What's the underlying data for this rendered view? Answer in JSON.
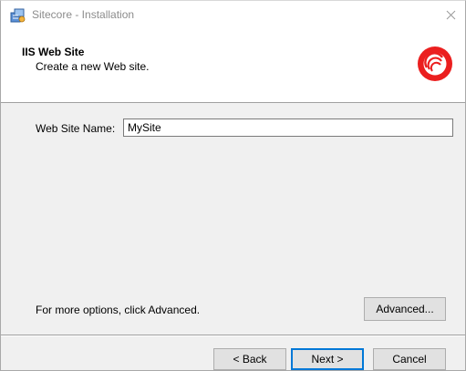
{
  "window": {
    "title": "Sitecore - Installation"
  },
  "header": {
    "title": "IIS Web Site",
    "subtitle": "Create a new Web site."
  },
  "form": {
    "website_name_label": "Web Site Name:",
    "website_name_value": "MySite"
  },
  "options": {
    "hint": "For more options, click Advanced.",
    "advanced_label": "Advanced..."
  },
  "footer": {
    "back_label": "< Back",
    "next_label": "Next >",
    "cancel_label": "Cancel"
  },
  "icons": {
    "app": "installer-icon",
    "close": "close-icon",
    "logo": "sitecore-logo-icon"
  },
  "colors": {
    "brand_red": "#eb1f1f",
    "focus_blue": "#0078d7",
    "title_gray": "#8c8c8c"
  }
}
